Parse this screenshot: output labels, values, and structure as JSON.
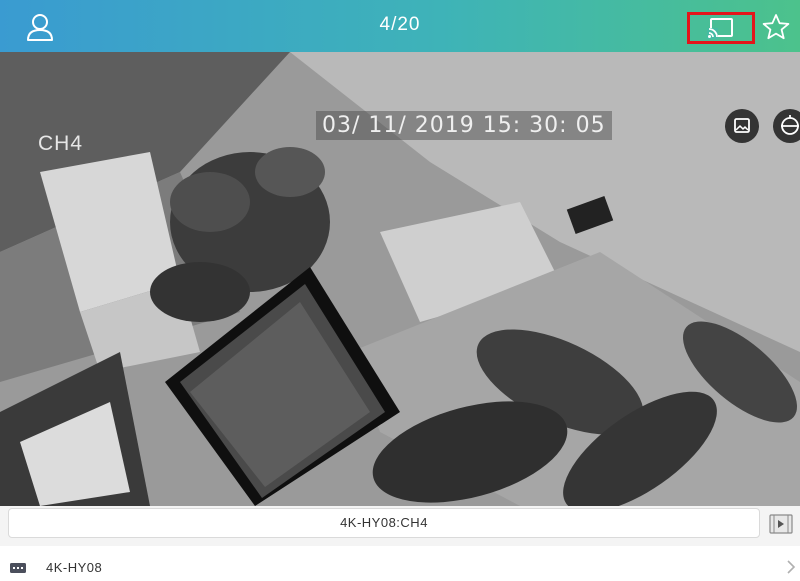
{
  "header": {
    "page_indicator": "4/20",
    "icons": [
      "user-icon",
      "cast-icon",
      "star-icon"
    ],
    "highlight_color": "#e3151b"
  },
  "video": {
    "channel_label": "CH4",
    "timestamp": "03/ 11/ 2019  15: 30: 05",
    "overlay_icons": [
      "image-icon",
      "ptz-icon"
    ]
  },
  "channel_bar": {
    "current_channel": "4K-HY08:CH4"
  },
  "device_list": {
    "items": [
      {
        "name": "4K-HY08"
      }
    ]
  },
  "colors": {
    "header_gradient_start": "#3a9bd1",
    "header_gradient_end": "#4cc28c"
  }
}
